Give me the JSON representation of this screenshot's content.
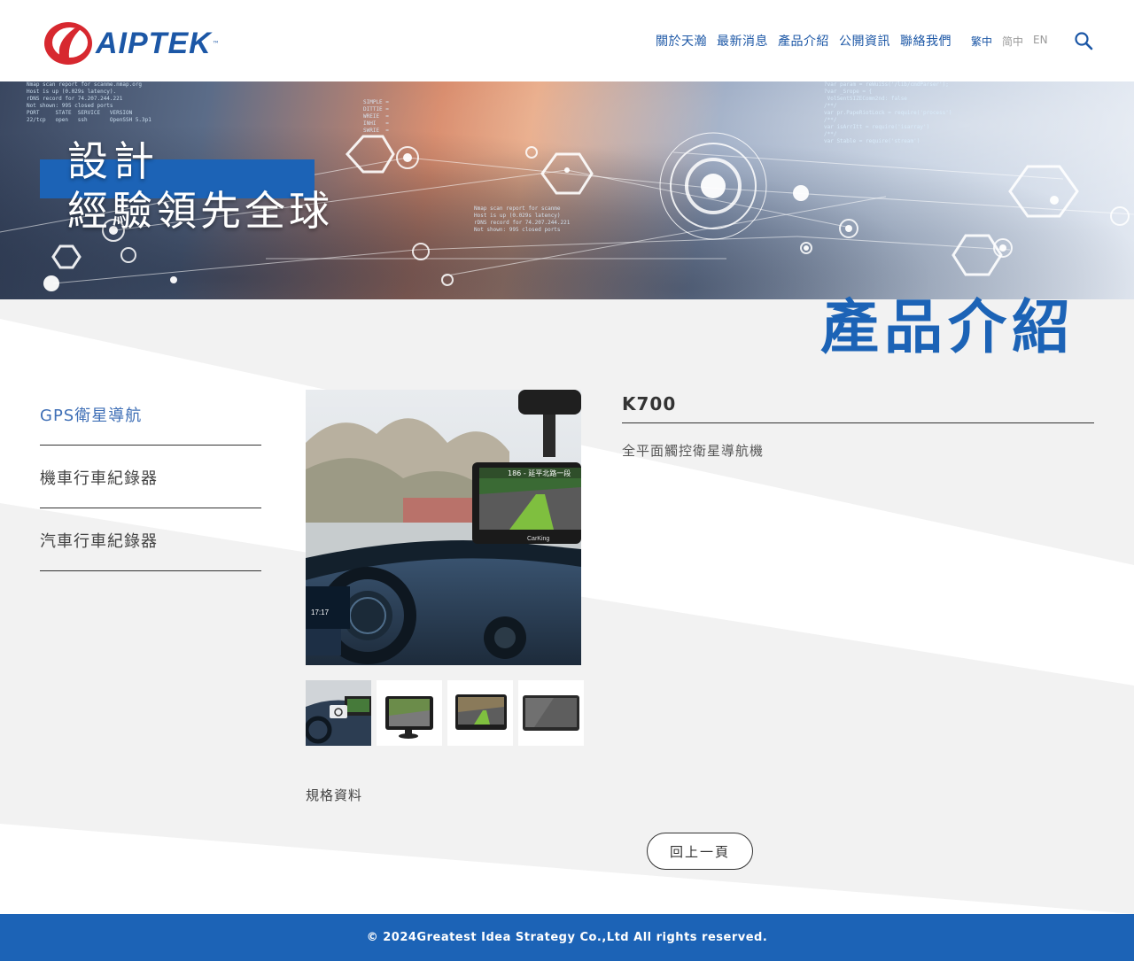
{
  "header": {
    "logo_text": "AIPTEK",
    "logo_tm": "™",
    "nav": [
      "關於天瀚",
      "最新消息",
      "產品介紹",
      "公開資訊",
      "聯絡我們"
    ],
    "languages": [
      "繁中",
      "简中",
      "EN"
    ],
    "active_language": "繁中"
  },
  "banner": {
    "line1": "設計",
    "line2": "經驗領先全球"
  },
  "section_title": "產品介紹",
  "sidebar": {
    "items": [
      {
        "label": "GPS衛星導航",
        "active": true
      },
      {
        "label": "機車行車紀錄器",
        "active": false
      },
      {
        "label": "汽車行車紀錄器",
        "active": false
      }
    ]
  },
  "product": {
    "name": "K700",
    "description": "全平面觸控衛星導航機",
    "gps_screen_text": "186 - 延平北路一段",
    "device_brand": "CarKing",
    "dash_time": "17:17",
    "thumbnails": 4
  },
  "spec_label": "規格資料",
  "back_button": "回上一頁",
  "footer": {
    "copyright": "© 2024Greatest Idea Strategy Co.,Ltd All rights reserved."
  },
  "colors": {
    "brand_blue": "#1c63b6",
    "nav_blue": "#1c57a6",
    "logo_red": "#d7282f",
    "active_side": "#3f6fb6"
  }
}
